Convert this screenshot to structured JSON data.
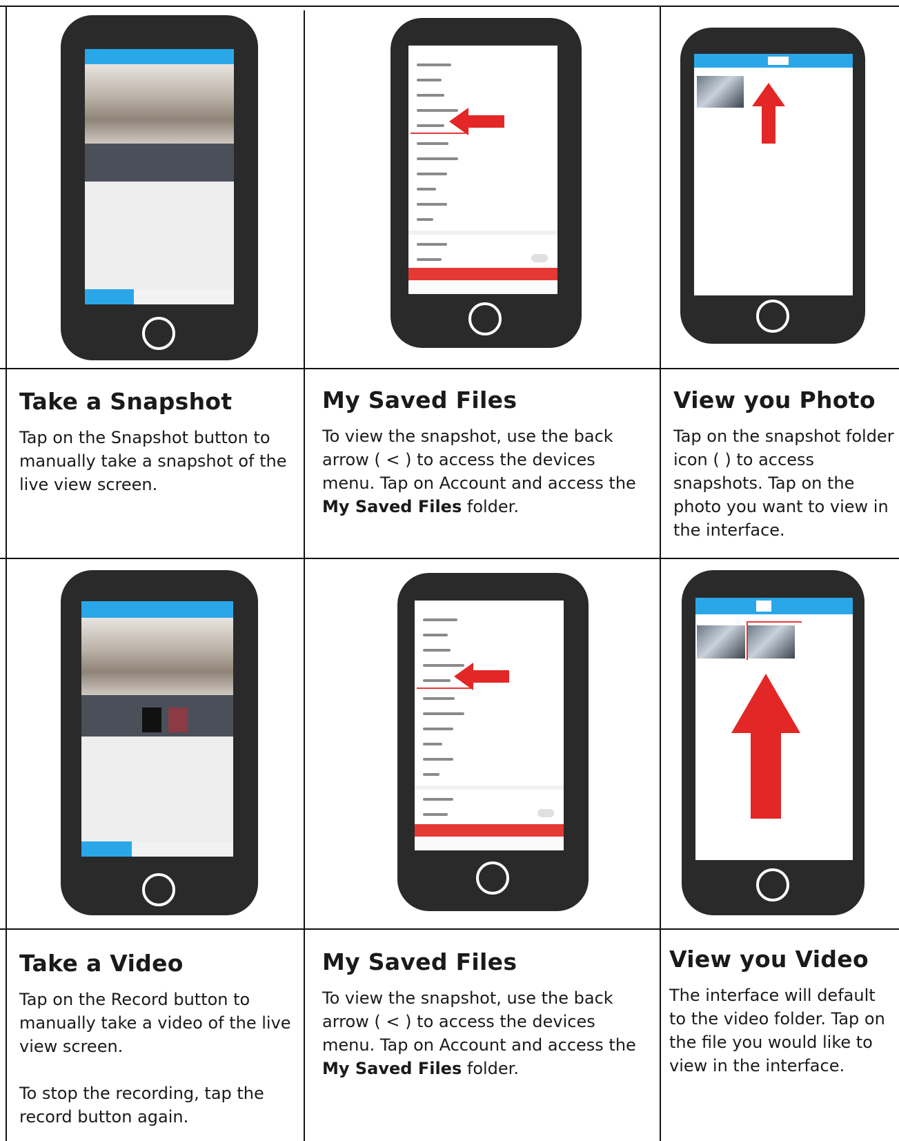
{
  "cells": [
    {
      "heading": "Take a Snapshot",
      "paragraphs": [
        "Tap on the Snapshot button to manually take a snapshot of the live view screen."
      ]
    },
    {
      "heading": "My Saved Files",
      "para_pre": "To view the snapshot, use the back arrow ( < ) to access the devices menu. Tap on Account and access the ",
      "para_bold": "My Saved Files",
      "para_post": " folder."
    },
    {
      "heading": "View you Photo",
      "paragraphs": [
        "Tap on the snapshot folder icon (      ) to access snapshots. Tap on the photo you want to view in the interface."
      ]
    },
    {
      "heading": "Take a Video",
      "paragraphs": [
        "Tap on the Record button to manually take a video of the live view screen.",
        "To stop the recording, tap the record button again."
      ]
    },
    {
      "heading": "My Saved Files",
      "para_pre": "To view the snapshot, use the back arrow ( < ) to access the devices menu. Tap on Account and access the ",
      "para_bold": "My Saved Files",
      "para_post": " folder."
    },
    {
      "heading": "View you Video",
      "paragraphs": [
        "The interface will default to the video folder. Tap on the file you would like to view in the interface."
      ]
    }
  ],
  "phones": [
    {
      "screen": "live-view"
    },
    {
      "screen": "devices-menu"
    },
    {
      "screen": "snapshot-folder"
    },
    {
      "screen": "live-view-recording"
    },
    {
      "screen": "devices-menu"
    },
    {
      "screen": "video-folder"
    }
  ],
  "colors": {
    "accent_blue": "#2aa7e8",
    "arrow_red": "#e32626",
    "phone_body": "#2a2a2a",
    "border": "#111111"
  }
}
